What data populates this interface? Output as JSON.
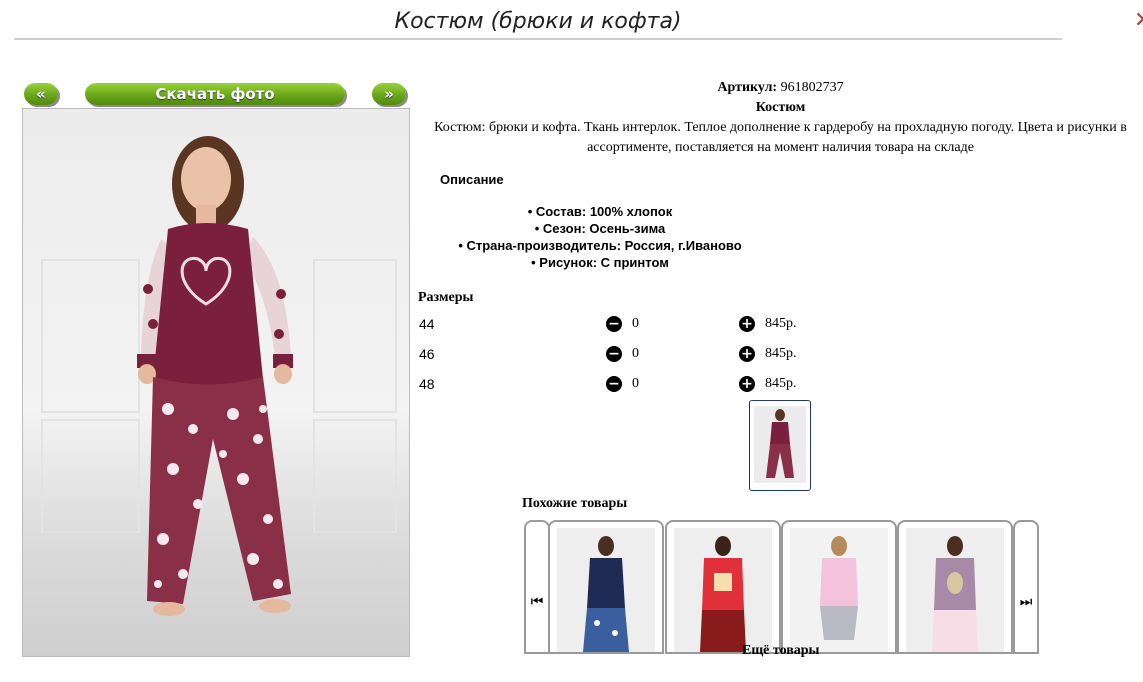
{
  "header": {
    "title": "Костюм (брюки и кофта)",
    "close_glyph": "✕"
  },
  "nav": {
    "prev_label": "«",
    "download_label": "Скачать фото",
    "next_label": "»"
  },
  "product": {
    "article_label": "Артикул:",
    "article_value": "961802737",
    "name": "Костюм",
    "description": "Костюм: брюки и кофта. Ткань интерлок. Теплое дополнение к гардеробу на прохладную погоду. Цвета и рисунки в ассортименте, поставляется на момент наличия товара на складе",
    "desc_title": "Описание",
    "specs": [
      "Состав: 100% хлопок",
      "Сезон: Осень-зима",
      "Страна-производитель: Россия, г.Иваново",
      "Рисунок: С принтом"
    ]
  },
  "sizes": {
    "title": "Размеры",
    "rows": [
      {
        "size": "44",
        "qty": "0",
        "price": "845р."
      },
      {
        "size": "46",
        "qty": "0",
        "price": "845р."
      },
      {
        "size": "48",
        "qty": "0",
        "price": "845р."
      }
    ]
  },
  "similar": {
    "title": "Похожие товары",
    "prev_icon": "skip-back-icon",
    "next_icon": "skip-forward-icon",
    "more_label": "Ещё товары"
  },
  "colors": {
    "accent_green": "#6aa718",
    "thumb_border": "#1e3a6d",
    "top_burgundy": "#7a1f3d"
  }
}
